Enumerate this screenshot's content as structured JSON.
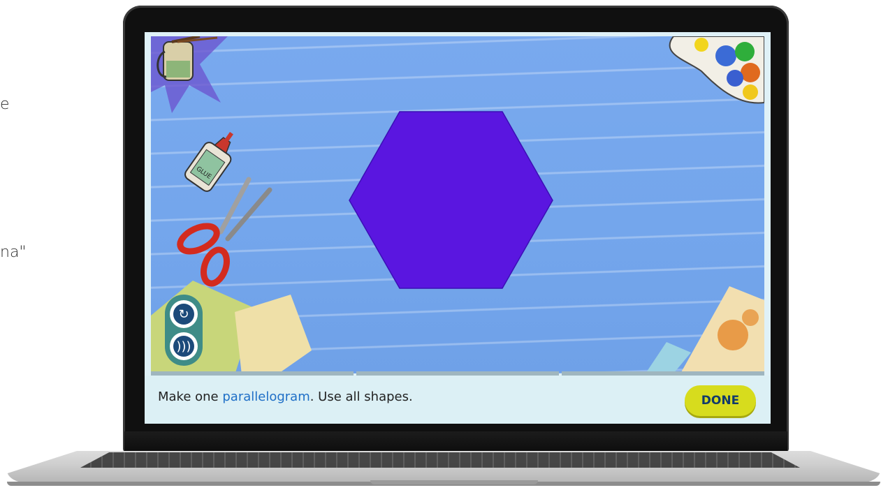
{
  "background_text": {
    "line1": "e",
    "line2": "na\""
  },
  "instruction": {
    "prefix": "Make one ",
    "keyword": "parallelogram",
    "suffix": ". Use all shapes."
  },
  "done_button": {
    "label": "DONE"
  },
  "controls": {
    "reset_icon": "refresh-icon",
    "audio_icon": "speaker-icon"
  },
  "shape": {
    "type": "hexagon",
    "color": "#5a16e0"
  },
  "decorations": [
    "paint-jar",
    "glue-bottle",
    "scissors",
    "paint-palette",
    "paper-sheets"
  ],
  "colors": {
    "accent": "#d7dc1d",
    "keyword": "#1f6fc7",
    "board": "#76a7ed"
  }
}
